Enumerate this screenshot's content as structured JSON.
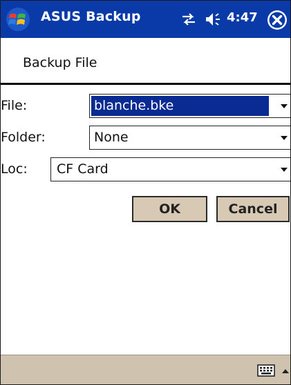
{
  "titlebar": {
    "app_title": "ASUS Backup",
    "time": "4:47",
    "start_icon": "windows-flag-icon",
    "connectivity_icon": "connectivity-arrows-icon",
    "volume_icon": "speaker-icon",
    "close_icon": "close-icon"
  },
  "dialog": {
    "title": "Backup File"
  },
  "form": {
    "file_label": "File:",
    "file_value": "blanche.bke",
    "folder_label": "Folder:",
    "folder_value": "None",
    "loc_label": "Loc:",
    "loc_value": "CF Card"
  },
  "buttons": {
    "ok_label": "OK",
    "cancel_label": "Cancel"
  },
  "menubar": {
    "keyboard_icon": "keyboard-icon",
    "sip_arrow_icon": "sip-arrow-icon"
  },
  "colors": {
    "titlebar_bg": "#0a3aa8",
    "selection_bg": "#0a2c92",
    "button_bg": "#d8c9b4",
    "menubar_bg": "#cfc3b0"
  }
}
